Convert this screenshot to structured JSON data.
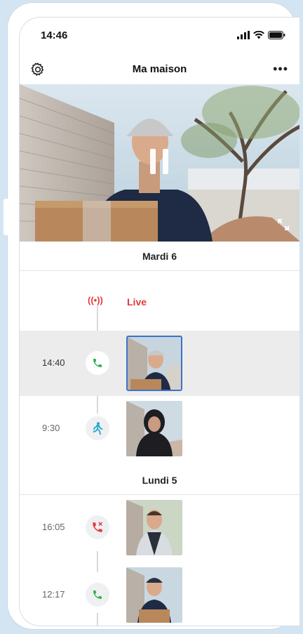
{
  "status_bar": {
    "time": "14:46"
  },
  "header": {
    "title": "Ma maison",
    "more_label": "•••"
  },
  "video": {
    "state": "paused"
  },
  "days": [
    {
      "label": "Mardi 6"
    },
    {
      "label": "Lundi 5"
    }
  ],
  "live": {
    "icon": "((•))",
    "label": "Live"
  },
  "events": [
    {
      "time": "14:40",
      "icon": "phone-answered-icon",
      "selected": true
    },
    {
      "time": "9:30",
      "icon": "motion-person-icon",
      "selected": false
    },
    {
      "time": "16:05",
      "icon": "phone-missed-icon",
      "selected": false
    },
    {
      "time": "12:17",
      "icon": "phone-answered-icon",
      "selected": false
    }
  ],
  "colors": {
    "accent_red": "#e23b3b",
    "answered_green": "#2fb24a",
    "motion_blue": "#2aa7c8",
    "selection_blue": "#3d73c8"
  }
}
